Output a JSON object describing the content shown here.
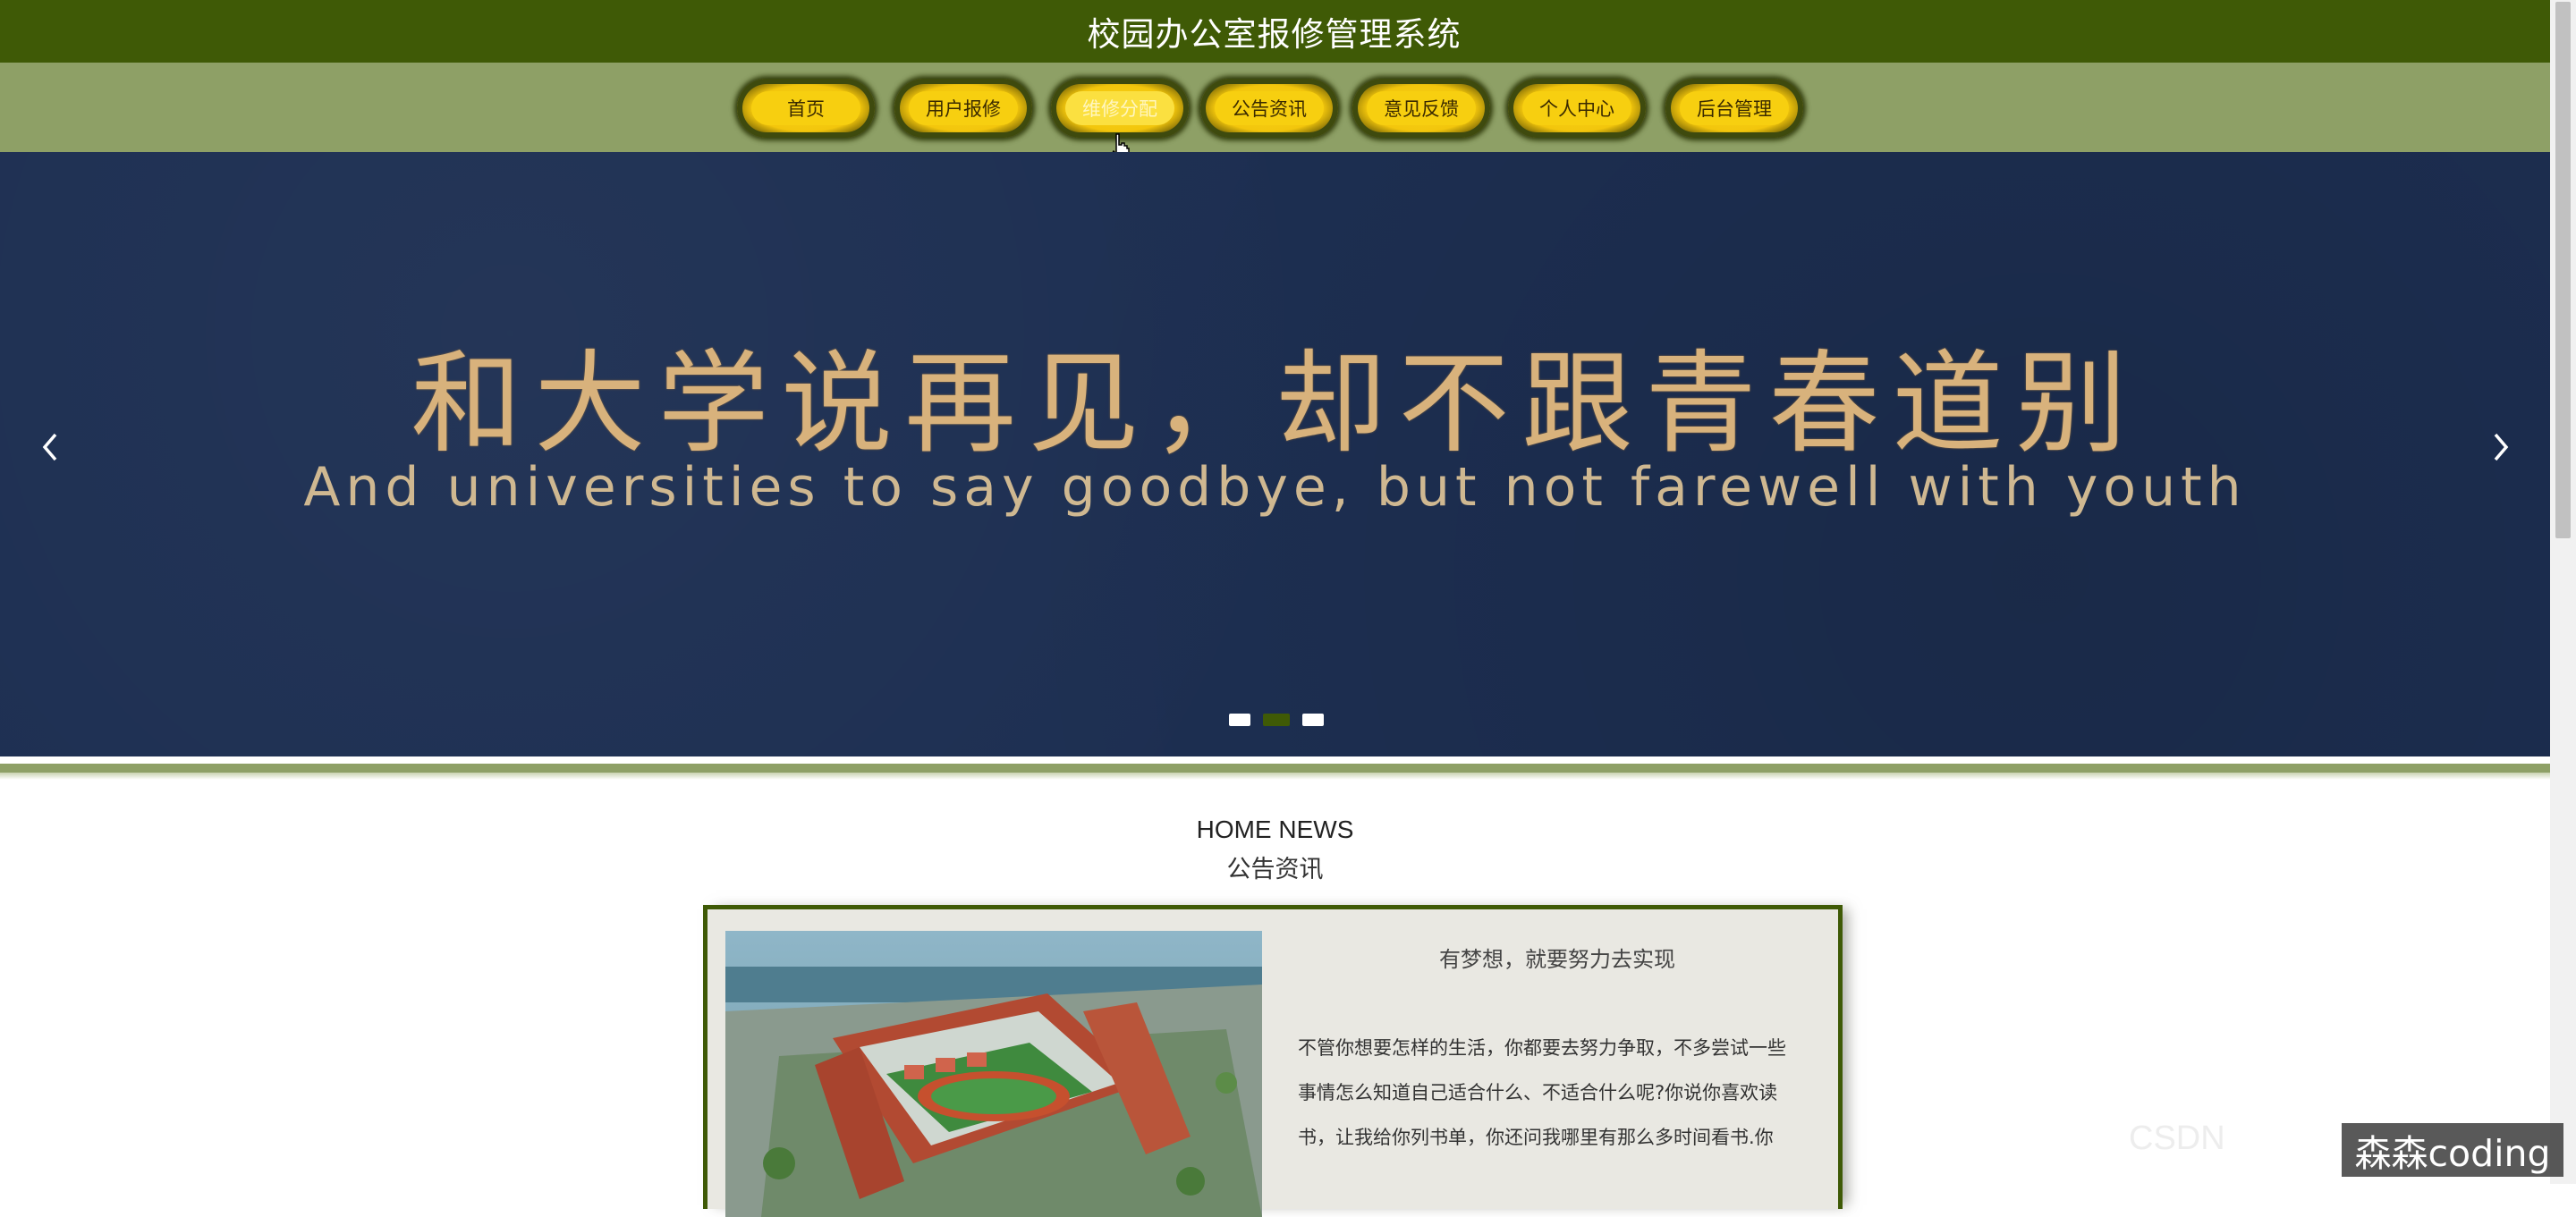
{
  "site": {
    "title": "校园办公室报修管理系统"
  },
  "nav": {
    "items": [
      {
        "label": "首页"
      },
      {
        "label": "用户报修"
      },
      {
        "label": "维修分配"
      },
      {
        "label": "公告资讯"
      },
      {
        "label": "意见反馈"
      },
      {
        "label": "个人中心"
      },
      {
        "label": "后台管理"
      }
    ],
    "active_index": 2
  },
  "banner": {
    "headline": "和大学说再见，却不跟青春道别",
    "subline": "And universities to say goodbye, but not farewell with youth",
    "prev_icon": "chevron-left-icon",
    "next_icon": "chevron-right-icon",
    "slide_count": 3,
    "active_slide": 2
  },
  "news": {
    "heading_en": "HOME NEWS",
    "heading_zh": "公告资讯",
    "item": {
      "title": "有梦想，就要努力去实现",
      "body_lines": [
        "不管你想要怎样的生活，你都要去努力争取，不多尝试一些",
        "事情怎么知道自己适合什么、不适合什么呢?你说你喜欢读",
        "书，让我给你列书单，你还问我哪里有那么多时间看书.你"
      ]
    }
  },
  "watermark": {
    "text": "森森coding",
    "faint": "CSDN"
  },
  "colors": {
    "topbar": "#3f5a06",
    "navbar": "#8ea066",
    "button": "#f7cf10",
    "banner": "#1d2f52",
    "banner_text": "#d8b27c"
  }
}
